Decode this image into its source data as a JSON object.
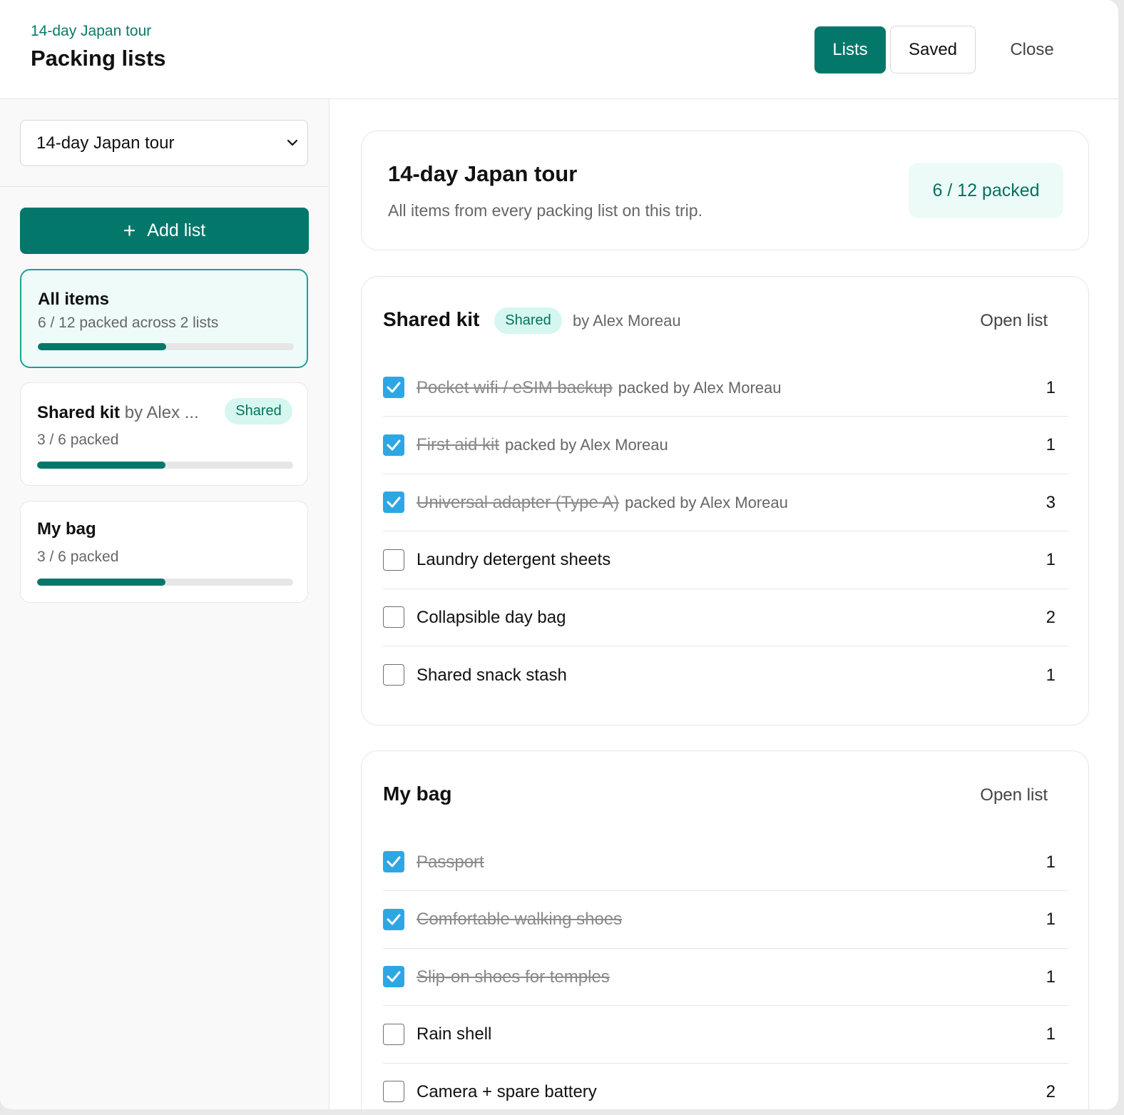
{
  "header": {
    "breadcrumb": "14-day Japan tour",
    "title": "Packing lists",
    "lists_button": "Lists",
    "saved_button": "Saved",
    "close_button": "Close"
  },
  "sidebar": {
    "trip_select": "14-day Japan tour",
    "add_list_label": "Add list",
    "cards": [
      {
        "title": "All items",
        "subtitle": "6 / 12 packed across 2 lists",
        "progress": 0.5
      },
      {
        "title": "Shared kit",
        "by": "by Alex ...",
        "badge": "Shared",
        "subtitle": "3 / 6 packed",
        "progress": 0.5
      },
      {
        "title": "My bag",
        "subtitle": "3 / 6 packed",
        "progress": 0.5
      }
    ]
  },
  "summary": {
    "title": "14-day Japan tour",
    "description": "All items from every packing list on this trip.",
    "packed": "6 / 12 packed"
  },
  "lists": [
    {
      "title": "Shared kit",
      "badge": "Shared",
      "by": "by Alex Moreau",
      "open_label": "Open list",
      "items": [
        {
          "name": "Pocket wifi / eSIM backup",
          "packed": true,
          "packed_by": "packed by Alex Moreau",
          "qty": "1"
        },
        {
          "name": "First aid kit",
          "packed": true,
          "packed_by": "packed by Alex Moreau",
          "qty": "1"
        },
        {
          "name": "Universal adapter (Type A)",
          "packed": true,
          "packed_by": "packed by Alex Moreau",
          "qty": "3"
        },
        {
          "name": "Laundry detergent sheets",
          "packed": false,
          "qty": "1"
        },
        {
          "name": "Collapsible day bag",
          "packed": false,
          "qty": "2"
        },
        {
          "name": "Shared snack stash",
          "packed": false,
          "qty": "1"
        }
      ]
    },
    {
      "title": "My bag",
      "open_label": "Open list",
      "items": [
        {
          "name": "Passport",
          "packed": true,
          "qty": "1"
        },
        {
          "name": "Comfortable walking shoes",
          "packed": true,
          "qty": "1"
        },
        {
          "name": "Slip-on shoes for temples",
          "packed": true,
          "qty": "1"
        },
        {
          "name": "Rain shell",
          "packed": false,
          "qty": "1"
        },
        {
          "name": "Camera + spare battery",
          "packed": false,
          "qty": "2"
        }
      ]
    }
  ],
  "colors": {
    "accent": "#04776b",
    "checkbox": "#2da7e3",
    "badge_bg": "#d5f7ef"
  }
}
